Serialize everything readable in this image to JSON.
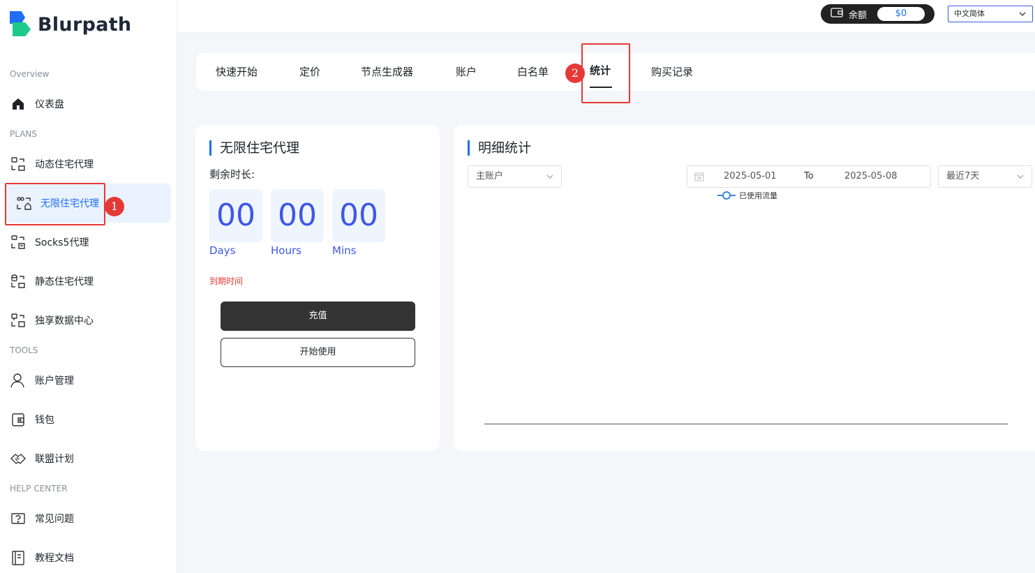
{
  "app": {
    "name": "Blurpath"
  },
  "sidebar": {
    "sections": {
      "overview": "Overview",
      "plans": "PLANS",
      "tools": "TOOLS",
      "help": "HELP CENTER"
    },
    "items": [
      {
        "label": "仪表盘",
        "icon": "home-icon"
      },
      {
        "label": "动态住宅代理",
        "icon": "dynamic-proxy-icon"
      },
      {
        "label": "无限住宅代理",
        "icon": "unlimited-proxy-icon",
        "active": true
      },
      {
        "label": "Socks5代理",
        "icon": "socks5-icon"
      },
      {
        "label": "静态住宅代理",
        "icon": "static-proxy-icon"
      },
      {
        "label": "独享数据中心",
        "icon": "datacenter-icon"
      },
      {
        "label": "账户管理",
        "icon": "user-icon"
      },
      {
        "label": "钱包",
        "icon": "wallet-icon"
      },
      {
        "label": "联盟计划",
        "icon": "handshake-icon"
      },
      {
        "label": "常见问题",
        "icon": "faq-icon"
      },
      {
        "label": "教程文档",
        "icon": "docs-icon"
      }
    ]
  },
  "topbar": {
    "balance_label": "余额",
    "balance_value": "$0",
    "language": "中文简体"
  },
  "tabs": [
    {
      "label": "快速开始"
    },
    {
      "label": "定价"
    },
    {
      "label": "节点生成器"
    },
    {
      "label": "账户"
    },
    {
      "label": "白名单"
    },
    {
      "label": "统计",
      "active": true
    },
    {
      "label": "购买记录"
    }
  ],
  "annotations": {
    "one": "1",
    "two": "2"
  },
  "plan_card": {
    "title": "无限住宅代理",
    "remaining_label": "剩余时长:",
    "days_value": "00",
    "hours_value": "00",
    "mins_value": "00",
    "days_label": "Days",
    "hours_label": "Hours",
    "mins_label": "Mins",
    "expire_label": "到期时间",
    "recharge_button": "充值",
    "start_button": "开始使用"
  },
  "stats_card": {
    "title": "明细统计",
    "account_select": "主账户",
    "date_start": "2025-05-01",
    "date_to": "To",
    "date_end": "2025-05-08",
    "range_select": "最近7天",
    "legend_label": "已使用流量"
  },
  "colors": {
    "accent": "#1f6ef5",
    "counter": "#3f57e8",
    "highlight": "#e53935",
    "expire_text": "#e53935"
  }
}
